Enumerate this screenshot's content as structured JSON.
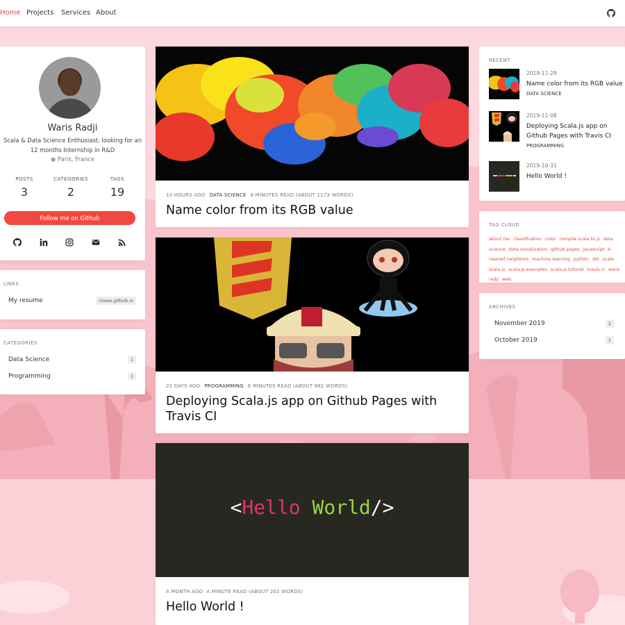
{
  "nav": {
    "items": [
      {
        "label": "Home",
        "active": true
      },
      {
        "label": "Projects"
      },
      {
        "label": "Services"
      },
      {
        "label": "About"
      }
    ],
    "github_icon": "github-icon"
  },
  "profile": {
    "name": "Waris Radji",
    "bio": "Scala & Data Science Enthusiast, looking for an 12 months Internship in R&D",
    "location": "Paris, France",
    "stats": [
      {
        "label": "POSTS",
        "value": "3"
      },
      {
        "label": "CATEGORIES",
        "value": "2"
      },
      {
        "label": "TAGS",
        "value": "19"
      }
    ],
    "follow_label": "Follow me on Github",
    "social_icons": [
      "github-icon",
      "linkedin-icon",
      "instagram-icon",
      "email-icon",
      "rss-icon"
    ]
  },
  "links": {
    "title": "LINKS",
    "items": [
      {
        "label": "My resume",
        "badge": "riiswa.github.io"
      }
    ]
  },
  "categories": {
    "title": "CATEGORIES",
    "items": [
      {
        "label": "Data Science",
        "count": "1"
      },
      {
        "label": "Programming",
        "count": "1"
      }
    ]
  },
  "posts": [
    {
      "time": "10 HOURS AGO",
      "category": "DATA SCIENCE",
      "read": "8 MINUTES READ (ABOUT 1173 WORDS)",
      "title": "Name color from its RGB value"
    },
    {
      "time": "21 DAYS AGO",
      "category": "PROGRAMMING",
      "read": "6 MINUTES READ (ABOUT 882 WORDS)",
      "title": "Deploying Scala.js app on Github Pages with Travis CI"
    },
    {
      "time": "A MONTH AGO",
      "category": "",
      "read": "A MINUTE READ (ABOUT 202 WORDS)",
      "title": "Hello World !",
      "hero_text": {
        "open": "<",
        "hello": "Hello",
        "world": "World",
        "close": "/>"
      }
    }
  ],
  "recent": {
    "title": "RECENT",
    "items": [
      {
        "date": "2019-11-28",
        "title": "Name color from its RGB value",
        "category": "DATA SCIENCE"
      },
      {
        "date": "2019-11-08",
        "title": "Deploying Scala.js app on Github Pages with Travis CI",
        "category": "PROGRAMMING"
      },
      {
        "date": "2019-10-31",
        "title": "Hello World !",
        "category": ""
      }
    ]
  },
  "tag_cloud": {
    "title": "TAG CLOUD",
    "tags": [
      "about me",
      "classification",
      "color",
      "compile scala to js",
      "data science",
      "data visualization",
      "github pages",
      "javascript",
      "k-nearest neighbors",
      "machine learning",
      "python",
      "sbt",
      "scala",
      "scala.js",
      "scala.js examples",
      "scala.js tutorial",
      "travis ci",
      "waris radji",
      "web"
    ]
  },
  "archives": {
    "title": "ARCHIVES",
    "items": [
      {
        "label": "November 2019",
        "count": "2"
      },
      {
        "label": "October 2019",
        "count": "1"
      }
    ]
  },
  "colors": {
    "accent": "#f0493f",
    "background": "#fdd9df",
    "hello": "#e0336e",
    "world": "#9ed53a"
  }
}
